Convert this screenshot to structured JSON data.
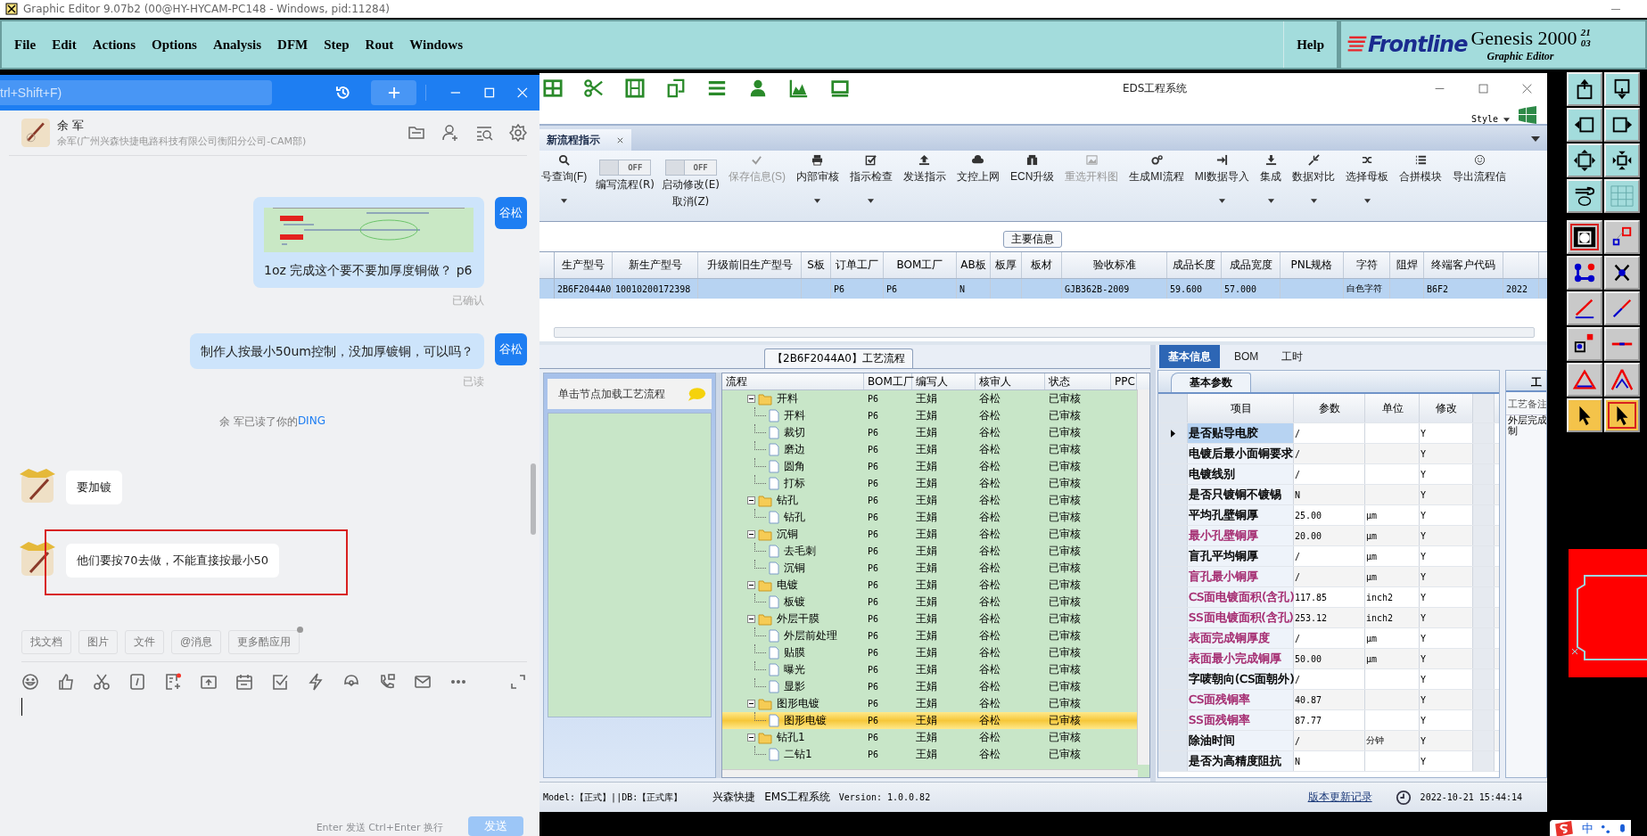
{
  "window": {
    "title": "Graphic Editor 9.07b2 (00@HY-HYCAM-PC148 - Windows, pid:11284)"
  },
  "menu": [
    "File",
    "Edit",
    "Actions",
    "Options",
    "Analysis",
    "DFM",
    "Step",
    "Rout",
    "Windows"
  ],
  "help": "Help",
  "brand": {
    "logo": "Frontline",
    "product": "Genesis 2000",
    "superscript": "21",
    "superscript_2": "03",
    "subtitle": "Graphic Editor"
  },
  "chat": {
    "search": {
      "placeholder": "trl+Shift+F)"
    },
    "contact": {
      "name": "余 军",
      "detail": "余军(广州兴森快捷电路科技有限公司衡阳分公司-CAM部)"
    },
    "messages": [
      {
        "kind": "outgoing",
        "avatar": "谷松",
        "text": "1oz 完成这个要不要加厚度铜做？ p6",
        "receipt": "已确认"
      },
      {
        "kind": "outgoing",
        "avatar": "谷松",
        "text": "制作人按最小50um控制，没加厚镀铜，可以吗？",
        "receipt": "已读"
      },
      {
        "kind": "notice",
        "text": "余 军已读了你的",
        "link": "DING"
      },
      {
        "kind": "incoming",
        "text": "要加镀",
        "highlighted": false
      },
      {
        "kind": "incoming",
        "text": "他们要按70去做，不能直接按最小50",
        "highlighted": true
      }
    ],
    "quick_actions": [
      {
        "label": "找文档",
        "dot": false
      },
      {
        "label": "图片",
        "dot": false
      },
      {
        "label": "文件",
        "dot": false
      },
      {
        "label": "@消息",
        "dot": false
      },
      {
        "label": "更多酷应用",
        "dot": true
      }
    ],
    "toolbar_alert": true,
    "hint": "Enter 发送  Ctrl+Enter 换行",
    "send_button": {
      "label": "发送",
      "disabled": true
    }
  },
  "eds": {
    "title": "EDS工程系统",
    "style_label": "Style",
    "tabs": [
      {
        "label": "新流程指示",
        "selected": true
      }
    ],
    "ribbon": [
      {
        "kind": "button",
        "label": "号查询(F)",
        "disabled": false,
        "dropdown": true
      },
      {
        "kind": "toggle",
        "state": "OFF",
        "on": false,
        "label": "编写流程(R)"
      },
      {
        "kind": "toggle",
        "state": "OFF",
        "on": false,
        "label": "启动修改(E)",
        "label_2": "取消(Z)"
      },
      {
        "kind": "button",
        "label": "保存信息(S)",
        "disabled": true,
        "dropdown": false
      },
      {
        "kind": "button",
        "label": "内部审核",
        "disabled": false,
        "dropdown": true
      },
      {
        "kind": "button",
        "label": "指示检查",
        "disabled": false,
        "dropdown": true
      },
      {
        "kind": "button",
        "label": "发送指示",
        "disabled": false,
        "dropdown": false
      },
      {
        "kind": "button",
        "label": "文控上网",
        "disabled": false,
        "dropdown": false
      },
      {
        "kind": "button",
        "label": "ECN升级",
        "disabled": false,
        "dropdown": false
      },
      {
        "kind": "button",
        "label": "重选开料图",
        "disabled": true,
        "dropdown": false
      },
      {
        "kind": "button",
        "label": "生成MI流程",
        "disabled": false,
        "dropdown": false
      },
      {
        "kind": "button",
        "label": "MI数据导入",
        "disabled": false,
        "dropdown": true
      },
      {
        "kind": "button",
        "label": "集成",
        "disabled": false,
        "dropdown": true
      },
      {
        "kind": "button",
        "label": "数据对比",
        "disabled": false,
        "dropdown": true
      },
      {
        "kind": "button",
        "label": "选择母板",
        "disabled": false,
        "dropdown": true
      },
      {
        "kind": "button",
        "label": "合拼模块",
        "disabled": false,
        "dropdown": false
      },
      {
        "kind": "button",
        "label": "导出流程信",
        "disabled": false,
        "dropdown": false
      }
    ],
    "group_label": "主要信息",
    "grid": {
      "columns": [
        "生产型号",
        "新生产型号",
        "升级前旧生产型号",
        "S板",
        "订单工厂",
        "BOM工厂",
        "AB板",
        "板厚",
        "板材",
        "验收标准",
        "成品长度",
        "成品宽度",
        "PNL规格",
        "字符",
        "阻焊",
        "终端客户代码"
      ],
      "rows": [
        {
          "selected": true,
          "cells": [
            "2B6F2044A0",
            "10010200172398",
            null,
            null,
            "P6",
            "P6",
            "N",
            null,
            null,
            "GJB362B-2009",
            "59.600",
            "57.000",
            null,
            "白色字符",
            null,
            "B6F2",
            "2022"
          ]
        }
      ]
    }
  },
  "process": {
    "title": "【2B6F2044A0】工艺流程",
    "hint": "单击节点加载工艺流程",
    "columns": [
      "流程",
      "BOM工厂",
      "编写人",
      "核审人",
      "状态",
      "PPC"
    ],
    "rows": [
      {
        "name": "开料",
        "bom": "P6",
        "writer": "王娟",
        "reviewer": "谷松",
        "status": "已审核",
        "expanded": true,
        "selected": false,
        "children": [
          {
            "name": "开料",
            "bom": "P6",
            "writer": "王娟",
            "reviewer": "谷松",
            "status": "已审核",
            "selected": false
          },
          {
            "name": "裁切",
            "bom": "P6",
            "writer": "王娟",
            "reviewer": "谷松",
            "status": "已审核",
            "selected": false
          },
          {
            "name": "磨边",
            "bom": "P6",
            "writer": "王娟",
            "reviewer": "谷松",
            "status": "已审核",
            "selected": false
          },
          {
            "name": "圆角",
            "bom": "P6",
            "writer": "王娟",
            "reviewer": "谷松",
            "status": "已审核",
            "selected": false
          },
          {
            "name": "打标",
            "bom": "P6",
            "writer": "王娟",
            "reviewer": "谷松",
            "status": "已审核",
            "selected": false
          }
        ]
      },
      {
        "name": "钻孔",
        "bom": "P6",
        "writer": "王娟",
        "reviewer": "谷松",
        "status": "已审核",
        "expanded": true,
        "selected": false,
        "children": [
          {
            "name": "钻孔",
            "bom": "P6",
            "writer": "王娟",
            "reviewer": "谷松",
            "status": "已审核",
            "selected": false
          }
        ]
      },
      {
        "name": "沉铜",
        "bom": "P6",
        "writer": "王娟",
        "reviewer": "谷松",
        "status": "已审核",
        "expanded": true,
        "selected": false,
        "children": [
          {
            "name": "去毛刺",
            "bom": "P6",
            "writer": "王娟",
            "reviewer": "谷松",
            "status": "已审核",
            "selected": false
          },
          {
            "name": "沉铜",
            "bom": "P6",
            "writer": "王娟",
            "reviewer": "谷松",
            "status": "已审核",
            "selected": false
          }
        ]
      },
      {
        "name": "电镀",
        "bom": "P6",
        "writer": "王娟",
        "reviewer": "谷松",
        "status": "已审核",
        "expanded": true,
        "selected": false,
        "children": [
          {
            "name": "板镀",
            "bom": "P6",
            "writer": "王娟",
            "reviewer": "谷松",
            "status": "已审核",
            "selected": false
          }
        ]
      },
      {
        "name": "外层干膜",
        "bom": "P6",
        "writer": "王娟",
        "reviewer": "谷松",
        "status": "已审核",
        "expanded": true,
        "selected": false,
        "children": [
          {
            "name": "外层前处理",
            "bom": "P6",
            "writer": "王娟",
            "reviewer": "谷松",
            "status": "已审核",
            "selected": false
          },
          {
            "name": "贴膜",
            "bom": "P6",
            "writer": "王娟",
            "reviewer": "谷松",
            "status": "已审核",
            "selected": false
          },
          {
            "name": "曝光",
            "bom": "P6",
            "writer": "王娟",
            "reviewer": "谷松",
            "status": "已审核",
            "selected": false
          },
          {
            "name": "显影",
            "bom": "P6",
            "writer": "王娟",
            "reviewer": "谷松",
            "status": "已审核",
            "selected": false
          }
        ]
      },
      {
        "name": "图形电镀",
        "bom": "P6",
        "writer": "王娟",
        "reviewer": "谷松",
        "status": "已审核",
        "expanded": true,
        "selected": false,
        "children": [
          {
            "name": "图形电镀",
            "bom": "P6",
            "writer": "王娟",
            "reviewer": "谷松",
            "status": "已审核",
            "selected": true
          }
        ]
      },
      {
        "name": "钻孔1",
        "bom": "P6",
        "writer": "王娟",
        "reviewer": "谷松",
        "status": "已审核",
        "expanded": true,
        "selected": false,
        "children": [
          {
            "name": "二钻1",
            "bom": "P6",
            "writer": "王娟",
            "reviewer": "谷松",
            "status": "已审核",
            "selected": false
          }
        ]
      }
    ]
  },
  "params": {
    "tabs": [
      {
        "label": "基本信息",
        "selected": true
      },
      {
        "label": "BOM",
        "selected": false
      },
      {
        "label": "工时",
        "selected": false
      }
    ],
    "sub_tab": "基本参数",
    "columns": [
      "项目",
      "参数",
      "单位",
      "修改"
    ],
    "rows": [
      {
        "item": "是否贴导电胶",
        "value": "/",
        "modified": "Y",
        "color": "#000000",
        "selected": true
      },
      {
        "item": "电镀后最小面铜要求",
        "value": "/",
        "modified": "Y",
        "color": "#000000",
        "selected": false
      },
      {
        "item": "电镀线别",
        "value": "/",
        "modified": "Y",
        "color": "#000000",
        "selected": false
      },
      {
        "item": "是否只镀铜不镀锡",
        "value": "N",
        "modified": "Y",
        "color": "#000000",
        "selected": false
      },
      {
        "item": "平均孔壁铜厚",
        "value": "25.00",
        "unit": "μm",
        "modified": "Y",
        "color": "#000000",
        "selected": false
      },
      {
        "item": "最小孔壁铜厚",
        "value": "20.00",
        "unit": "μm",
        "modified": "Y",
        "color": "#a3286e",
        "selected": false
      },
      {
        "item": "盲孔平均铜厚",
        "value": "/",
        "unit": "μm",
        "modified": "Y",
        "color": "#000000",
        "selected": false
      },
      {
        "item": "盲孔最小铜厚",
        "value": "/",
        "unit": "μm",
        "modified": "Y",
        "color": "#a3286e",
        "selected": false
      },
      {
        "item": "CS面电镀面积(含孔)",
        "value": "117.85",
        "unit": "inch2",
        "modified": "Y",
        "color": "#a3286e",
        "selected": false
      },
      {
        "item": "SS面电镀面积(含孔)",
        "value": "253.12",
        "unit": "inch2",
        "modified": "Y",
        "color": "#a3286e",
        "selected": false
      },
      {
        "item": "表面完成铜厚度",
        "value": "/",
        "unit": "μm",
        "modified": "Y",
        "color": "#a3286e",
        "selected": false
      },
      {
        "item": "表面最小完成铜厚",
        "value": "50.00",
        "unit": "μm",
        "modified": "Y",
        "color": "#a3286e",
        "selected": false
      },
      {
        "item": "字唛朝向(CS面朝外)",
        "value": "/",
        "modified": "Y",
        "color": "#000000",
        "selected": false
      },
      {
        "item": "CS面残铜率",
        "value": "40.87",
        "modified": "Y",
        "color": "#a3286e",
        "selected": false
      },
      {
        "item": "SS面残铜率",
        "value": "87.77",
        "modified": "Y",
        "color": "#a3286e",
        "selected": false
      },
      {
        "item": "除油时间",
        "value": "/",
        "unit": "分钟",
        "modified": "Y",
        "color": "#000000",
        "selected": false
      },
      {
        "item": "是否为高精度阻抗",
        "value": "N",
        "modified": "Y",
        "color": "#000000",
        "selected": false
      }
    ],
    "side_tab": "工",
    "notes_label": "工艺备注",
    "notes": [
      "外层完成",
      "制"
    ]
  },
  "status_bar": {
    "model": "Model:【正式】||DB:【正式库】",
    "company": "兴森快捷",
    "system": "EMS工程系统",
    "version": "Version: 1.0.0.82",
    "link": "版本更新记录",
    "datetime": "2022-10-21 15:44:14"
  },
  "genesis": {
    "tools": [
      {
        "selected": false
      },
      {
        "selected": false
      },
      {
        "selected": false
      },
      {
        "selected": false
      },
      {
        "selected": false
      },
      {
        "selected": false
      },
      {
        "selected": false
      },
      {
        "selected": false
      },
      {
        "selected": true
      },
      {
        "selected": false
      },
      {
        "selected": false
      },
      {
        "selected": false
      },
      {
        "selected": false
      },
      {
        "selected": false
      },
      {
        "selected": false
      },
      {
        "selected": false
      },
      {
        "selected": false
      },
      {
        "selected": false
      },
      {
        "selected": false
      },
      {
        "selected": true
      }
    ]
  },
  "ime": {
    "mode": "中"
  }
}
